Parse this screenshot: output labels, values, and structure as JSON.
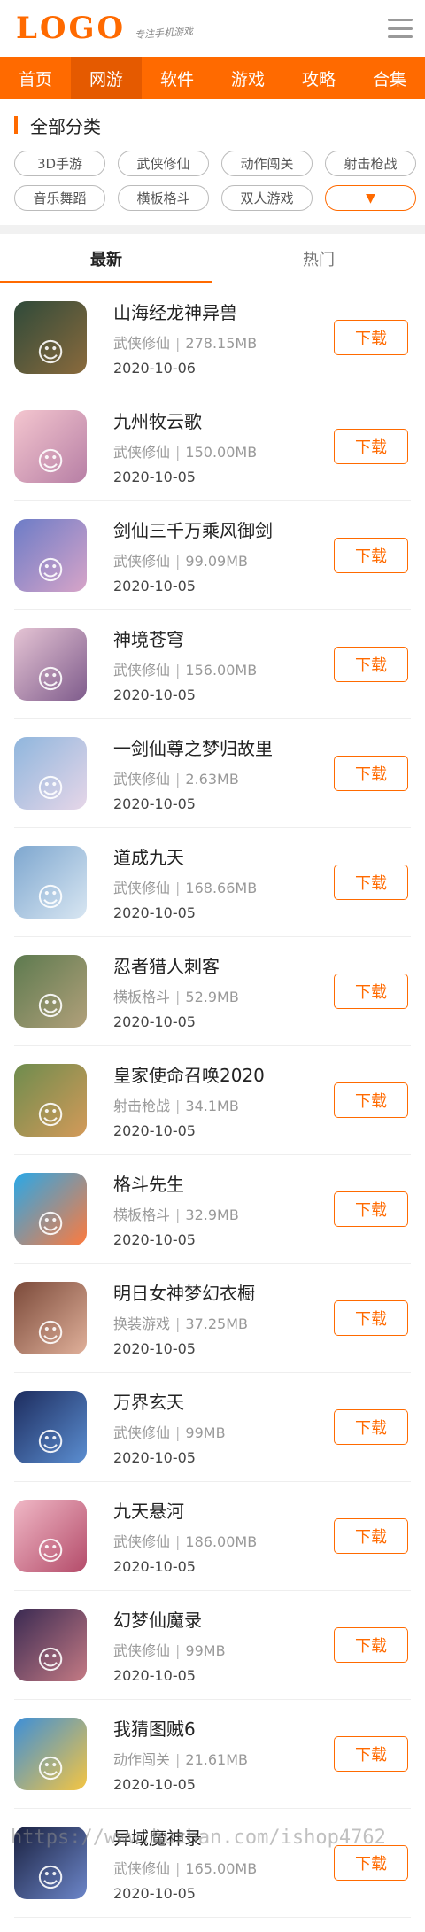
{
  "header": {
    "logo": "LOGO",
    "slogan": "专注手机游戏"
  },
  "nav": [
    "首页",
    "网游",
    "软件",
    "游戏",
    "攻略",
    "合集"
  ],
  "nav_active_index": 1,
  "category": {
    "title": "全部分类",
    "tags": [
      "3D手游",
      "武侠修仙",
      "动作闯关",
      "射击枪战",
      "音乐舞蹈",
      "横板格斗",
      "双人游戏"
    ],
    "more": "▼"
  },
  "tabs": [
    "最新",
    "热门"
  ],
  "tab_active_index": 0,
  "download_label": "下载",
  "games": [
    {
      "title": "山海经龙神异兽",
      "category": "武侠修仙",
      "size": "278.15MB",
      "date": "2020-10-06",
      "icon": "dragon-icon",
      "color_a": "#2f4a3a",
      "color_b": "#8a6a3c"
    },
    {
      "title": "九州牧云歌",
      "category": "武侠修仙",
      "size": "150.00MB",
      "date": "2020-10-05",
      "icon": "heroine-icon",
      "color_a": "#f4c6cf",
      "color_b": "#b77fa5"
    },
    {
      "title": "剑仙三千万乘风御剑",
      "category": "武侠修仙",
      "size": "99.09MB",
      "date": "2020-10-05",
      "icon": "swordswoman-icon",
      "color_a": "#6c7cc7",
      "color_b": "#d7a4c8"
    },
    {
      "title": "神境苍穹",
      "category": "武侠修仙",
      "size": "156.00MB",
      "date": "2020-10-05",
      "icon": "fairy-icon",
      "color_a": "#e5c4d4",
      "color_b": "#7f5c8c"
    },
    {
      "title": "一剑仙尊之梦归故里",
      "category": "武侠修仙",
      "size": "2.63MB",
      "date": "2020-10-05",
      "icon": "immortal-icon",
      "color_a": "#8fb6dd",
      "color_b": "#e6d6e8"
    },
    {
      "title": "道成九天",
      "category": "武侠修仙",
      "size": "168.66MB",
      "date": "2020-10-05",
      "icon": "sage-icon",
      "color_a": "#7ea7cf",
      "color_b": "#d8e6f2"
    },
    {
      "title": "忍者猎人刺客",
      "category": "横板格斗",
      "size": "52.9MB",
      "date": "2020-10-05",
      "icon": "soldier-icon",
      "color_a": "#5d7a4f",
      "color_b": "#b1a07a"
    },
    {
      "title": "皇家使命召唤2020",
      "category": "射击枪战",
      "size": "34.1MB",
      "date": "2020-10-05",
      "icon": "gunner-icon",
      "color_a": "#6e8c4e",
      "color_b": "#d39a59"
    },
    {
      "title": "格斗先生",
      "category": "横板格斗",
      "size": "32.9MB",
      "date": "2020-10-05",
      "icon": "fighter-icon",
      "color_a": "#29a8e8",
      "color_b": "#ff7a3d"
    },
    {
      "title": "明日女神梦幻衣橱",
      "category": "换装游戏",
      "size": "37.25MB",
      "date": "2020-10-05",
      "icon": "goddess-icon",
      "color_a": "#7b4a3a",
      "color_b": "#e0b09a"
    },
    {
      "title": "万界玄天",
      "category": "武侠修仙",
      "size": "99MB",
      "date": "2020-10-05",
      "icon": "warrior-icon",
      "color_a": "#1d2c5e",
      "color_b": "#5b8ed1"
    },
    {
      "title": "九天悬河",
      "category": "武侠修仙",
      "size": "186.00MB",
      "date": "2020-10-05",
      "icon": "maiden-icon",
      "color_a": "#f0b8c6",
      "color_b": "#b44c6a"
    },
    {
      "title": "幻梦仙魔录",
      "category": "武侠修仙",
      "size": "99MB",
      "date": "2020-10-05",
      "icon": "demon-icon",
      "color_a": "#3a2a52",
      "color_b": "#c47a84"
    },
    {
      "title": "我猜图贼6",
      "category": "动作闯关",
      "size": "21.61MB",
      "date": "2020-10-05",
      "icon": "puzzle-icon",
      "color_a": "#3d8fd8",
      "color_b": "#f5c542"
    },
    {
      "title": "异域魔神录",
      "category": "武侠修仙",
      "size": "165.00MB",
      "date": "2020-10-05",
      "icon": "swordsman-icon",
      "color_a": "#1a2140",
      "color_b": "#6c86c9"
    }
  ],
  "watermark": "https://www.huzhan.com/ishop4762"
}
